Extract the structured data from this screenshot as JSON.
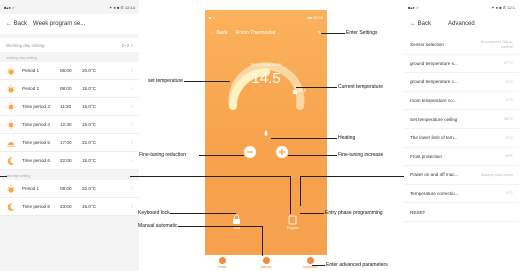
{
  "left": {
    "status_left": "■▴● ✓",
    "status_right": "✶ ● ■ ✆ 12:14",
    "back": "← Back",
    "title": "Week program se...",
    "working_day_setting": {
      "label": "Working day setting",
      "value": "5+2 >"
    },
    "working_day_header": "working day setting",
    "periods": [
      {
        "name": "Period 1",
        "time": "06:00",
        "temp": "20.0°C",
        "icon": "sunrise-icon"
      },
      {
        "name": "Period 2",
        "time": "08:00",
        "temp": "15.0°C",
        "icon": "sunrise-icon"
      },
      {
        "name": "Time period 3",
        "time": "11:30",
        "temp": "15.0°C",
        "icon": "sun-icon"
      },
      {
        "name": "Time period 4",
        "time": "12:30",
        "temp": "15.0°C",
        "icon": "sun-icon"
      },
      {
        "name": "Time period 5",
        "time": "17:00",
        "temp": "22.0°C",
        "icon": "sunset-icon"
      },
      {
        "name": "Time period 6",
        "time": "22:00",
        "temp": "15.0°C",
        "icon": "moon-icon"
      }
    ],
    "rest_day_header": "rest day setting",
    "rest_periods": [
      {
        "name": "Period 1",
        "time": "08:00",
        "temp": "22.0°C",
        "icon": "sunrise-icon"
      },
      {
        "name": "Time period 6",
        "time": "23:00",
        "temp": "15.0°C",
        "icon": "moon-icon"
      }
    ]
  },
  "center": {
    "status_left": "■ ✓",
    "status_right": "●■ 10:38",
    "back": "← Back",
    "title": "Room Thermostat",
    "set_label": "Set temperature",
    "set_value": "14.5",
    "current_value": "20.5",
    "bottom": [
      "Power",
      "Manual",
      "Advanced"
    ],
    "lock_label": "Lock",
    "program_label": "Program"
  },
  "right": {
    "status_left": "■▴● ✓",
    "status_right": "✶ ● ■ ✆ 12:1",
    "back": "← Back",
    "title": "Advanced",
    "rows": [
      {
        "label": "Sensor selection",
        "value": "In-s-control Out-s-control"
      },
      {
        "label": "ground temperature s...",
        "value": "47°C"
      },
      {
        "label": "ground temperature c...",
        "value": "2°C"
      },
      {
        "label": "room temperature co...",
        "value": "1°C"
      },
      {
        "label": "Set temperature ceiling",
        "value": "35°C"
      },
      {
        "label": "The lower limit of tem...",
        "value": "5°C"
      },
      {
        "label": "Frost protection",
        "value": "OFF"
      },
      {
        "label": "Power on and off mac...",
        "value": "Always shut down"
      },
      {
        "label": "Temperature correctio...",
        "value": "0°C"
      },
      {
        "label": "RESET",
        "value": ""
      }
    ]
  },
  "annotations": {
    "enter_settings": "Enter Settings",
    "set_temperature": "set temperature",
    "current_temperature": "Current temperature",
    "heating": "Heating",
    "fine_reduction": "Fine-tuning reduction",
    "fine_increase": "Fine-tuning increase",
    "keyboard_lock": "Keyboard lock",
    "manual_automatic": "Manual automatic",
    "entry_phase": "Entry phase programming",
    "enter_advanced": "Enter advanced parameters"
  }
}
